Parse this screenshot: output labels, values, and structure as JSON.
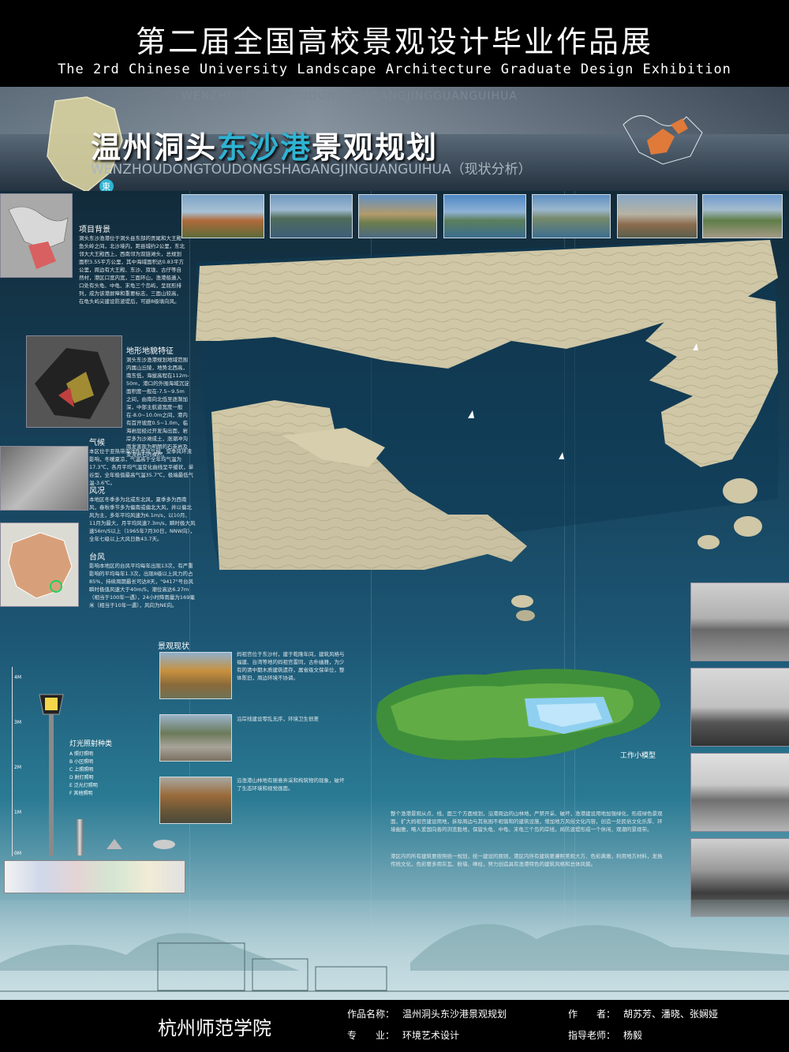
{
  "header": {
    "title_cn": "第二届全国高校景观设计毕业作品展",
    "title_en": "The 2rd Chinese University Landscape Architecture Graduate Design Exhibition"
  },
  "banner": {
    "title_part1": "温州洞头",
    "title_highlight": "东沙港",
    "title_part2": "景观规划",
    "title_en": "WENZHOUDONGTOUDONGSHAGANGJINGUANGUIHUA（现状分析）",
    "watermark": "WENZHOUDONGTOUDONGSHAGANGJINGGUANGUIHUA",
    "map_marker": "東"
  },
  "left_sections": [
    {
      "title": "项目背景",
      "body": "洞头东沙渔港位于洞头县东部的贡尾和大王殿鱼头岭之间，北沙境内，距县城约2公里，东北邻大大王殿西上，西南邻为双链滩头，总规划面积3.55平方公里，其中海域面积达0.83平方公里，周边有大王殿、东沙、双垅、古仔等自然村，港区口宽内宽，三面环山，渔港船遁入口处有头龟、中龟、末龟三个岛屿，呈屈形排列，成为该港屏障和重要标志，三面山较高，在龟头屿尖建设防波堤后，可避8级填向风。"
    },
    {
      "title": "地形地貌特征",
      "body": "洞头东沙渔港规划地域范围内属山丘陵，地势北西高，南东低，海拔高程在112m-50m，港口的外围海域沉淀面积度一般在-7.5~9.5m之间，由南向北低至逐渐加深，中部主航道宽度一般在-8.0~10.0m之间，港内有首开坡度0.5~1.0m，临海岩层经过开发淘出面，岩岸多为沙滩成土，涨潮冲沟雨发害现为明朗的石英岩及变流岩石的裸积。"
    },
    {
      "title": "气候",
      "body": "本区位于亚热带海洋性季风气候，受季风环流影响，冬暖夏凉，气温高于全年均气温为17.3℃，各月平均气温变化曲线呈平缓状，单谷型，全年极值最高气温35.7℃，极端最低气温-3.6℃。"
    },
    {
      "title": "风况",
      "body": "本地区冬季多为北或东北风，夏季多为西南风，春秋季节多为偏南或偏北大风，并以偏北风为主，多年平均风速为6.1m/s，以10月、11月为最大，月平均风速7.3m/s，瞬时极大风速56m/S以上（1965年7月30日，NNW向），全年七级以上大风日数43.7天。"
    },
    {
      "title": "台风",
      "body": "影响本地区的台风平均每年出现13次，有严重影响的平均每年1.3次，出现8级以上风力的占85%，持续周期最长可达8天，\"9417\"号台风瞬时极值风速大于40m/S，潮位高达6.27m（相当于100年一遇），24小时降雨量为169毫米（相当于10年一遇），风向为NE向。"
    }
  ],
  "landscape_section": {
    "title": "景观现状",
    "items": [
      "妈祖宫位于东沙村，建于乾隆年间，建筑风格与福建、台湾等地的妈祖宫雷同，古朴幽雅，为少有的清中期木质建筑遗存，属省级文保单位，整体陈旧，周边环境不协调。",
      "沿岸线建设零乱无序，环境卫生很差",
      "沿渔港山林地有随意弄采和构筑物的现象，破坏了生态环境和视觉画面。"
    ]
  },
  "model_label": "工作小模型",
  "summary": [
    "整个渔港景观从点、线、面三个方面规划，沿港周边的山林地，严禁开采、破坏，渔港建设用地加强绿化，形成绿色景观面，扩大妈祖宫建设用地，拆除周边与其氛围不相谐和的建筑设施，增加地方风俗文化内容，创造一处民俗文化乐厚、环境幽雅，略人爱国向善的浏览胜地，保留头龟、中龟、末龟三个岛的岸线，局防波堤形成一个休闲、观潮的景观带。",
    "港区内的所有建筑要按照统一规划，统一建设的原则，港区内所有建筑要遵照美观大方、色彩典雅，利用地方材料，发扬传统文化，色彩要多用灰瓦、粉墙、峰柱，努力创造具有渔港特色的建筑风格和总体风貌。"
  ],
  "lamp_legend": {
    "title": "灯光照射种类",
    "items": [
      "A 照灯照明",
      "B 小区照明",
      "C 上照照明",
      "D 射灯照明",
      "E 泛光灯照明",
      "F 其他照明"
    ],
    "scale": [
      "4M",
      "3M",
      "2M",
      "1M",
      "0M"
    ]
  },
  "footer": {
    "school": "杭州师范学院",
    "work_label": "作品名称：",
    "work_name": "温州洞头东沙港景观规划",
    "author_label": "作　　者：",
    "authors": "胡苏芳、潘晓、张娴娅",
    "major_label": "专　　业：",
    "major": "环境艺术设计",
    "advisor_label": "指导老师：",
    "advisor": "杨毅"
  },
  "colors": {
    "accent": "#2fb3d3",
    "terrain": "#c9c1a1",
    "ocean": "#1c5674"
  }
}
